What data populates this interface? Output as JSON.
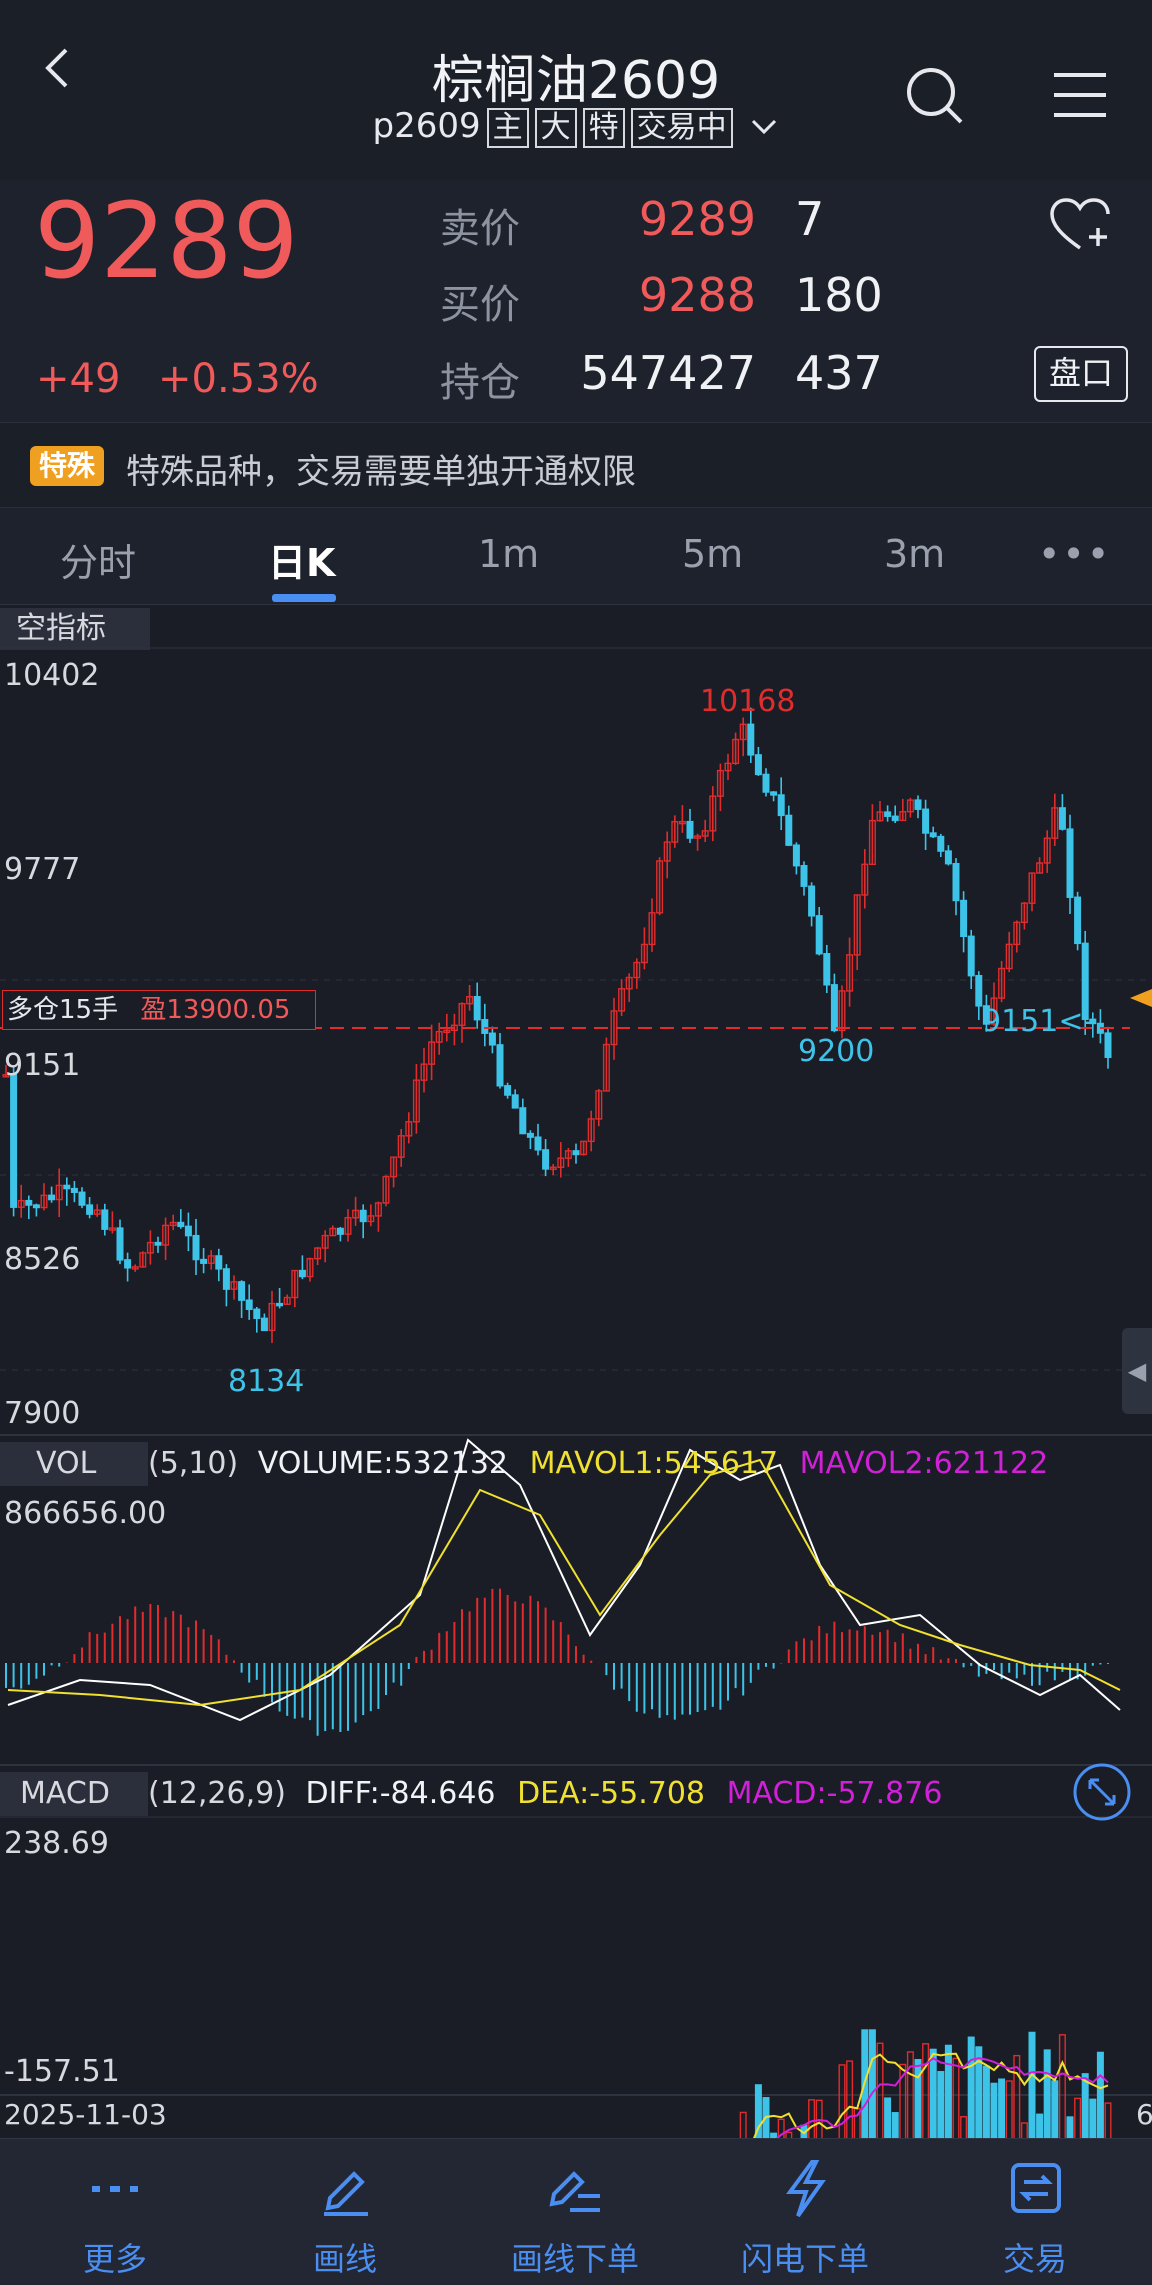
{
  "header": {
    "title": "棕榈油2609",
    "code": "p2609",
    "tags": [
      "主",
      "大",
      "特",
      "交易中"
    ]
  },
  "quote": {
    "last": "9289",
    "change": "+49",
    "change_pct": "+0.53%",
    "ask_label": "卖价",
    "ask": "9289",
    "ask_qty": "7",
    "bid_label": "买价",
    "bid": "9288",
    "bid_qty": "180",
    "oi_label": "持仓",
    "oi": "547427",
    "oi_chg": "437",
    "depth_button": "盘口"
  },
  "notice": {
    "badge": "特殊",
    "text": "特殊品种，交易需要单独开通权限"
  },
  "tabs": [
    "分时",
    "日K",
    "1m",
    "5m",
    "3m",
    "•••"
  ],
  "active_tab": "日K",
  "main_chart": {
    "indicator_label": "空指标",
    "y_labels": [
      "10402",
      "9777",
      "9151",
      "8526",
      "7900"
    ],
    "high_label": "10168",
    "low_label": "8134",
    "mid_low_label": "9200",
    "position_label": "多仓15手",
    "pnl_label": "盈13900.05",
    "current_marker": "9151<-"
  },
  "vol": {
    "name": "VOL",
    "params": "(5,10)",
    "volume": "VOLUME:532132",
    "mavol1": "MAVOL1:545617",
    "mavol2": "MAVOL2:621122",
    "max": "866656.00"
  },
  "macd": {
    "name": "MACD",
    "params": "(12,26,9)",
    "diff": "DIFF:-84.646",
    "dea": "DEA:-55.708",
    "macd": "MACD:-57.876",
    "max": "238.69",
    "min": "-157.51"
  },
  "date_label": "2025-11-03",
  "date_right": "6",
  "bottom_nav": [
    "更多",
    "画线",
    "画线下单",
    "闪电下单",
    "交易"
  ],
  "colors": {
    "up": "#e02c2c",
    "down": "#3ec3e8",
    "accent": "#4a8ef2"
  }
}
